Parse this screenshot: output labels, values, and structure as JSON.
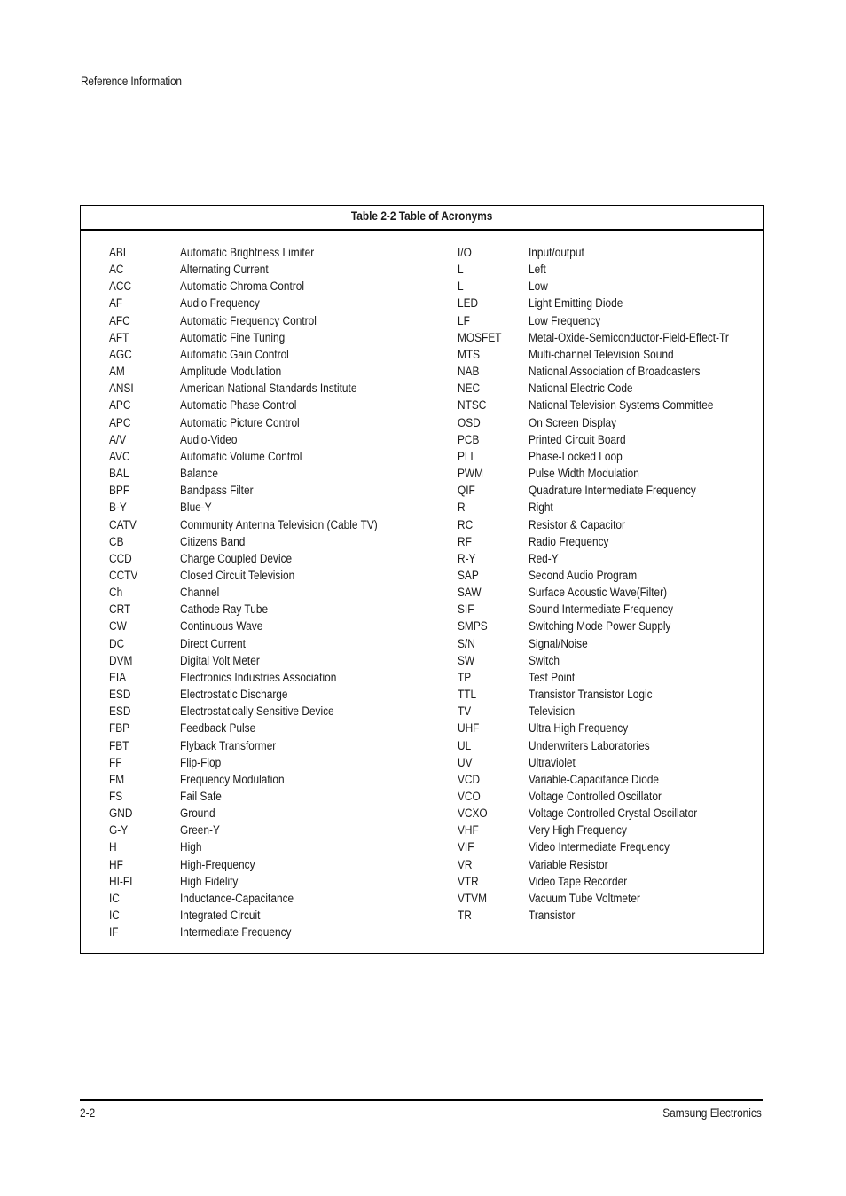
{
  "header": {
    "running_head": "Reference Information"
  },
  "table": {
    "title": "Table 2-2 Table of Acronyms",
    "left_column": [
      {
        "abbr": "ABL",
        "def": "Automatic Brightness Limiter"
      },
      {
        "abbr": "AC",
        "def": "Alternating Current"
      },
      {
        "abbr": "ACC",
        "def": "Automatic Chroma Control"
      },
      {
        "abbr": "AF",
        "def": "Audio Frequency"
      },
      {
        "abbr": "AFC",
        "def": "Automatic Frequency Control"
      },
      {
        "abbr": "AFT",
        "def": "Automatic Fine Tuning"
      },
      {
        "abbr": "AGC",
        "def": "Automatic Gain Control"
      },
      {
        "abbr": "AM",
        "def": "Amplitude Modulation"
      },
      {
        "abbr": "ANSI",
        "def": "American National Standards Institute"
      },
      {
        "abbr": "APC",
        "def": "Automatic Phase Control"
      },
      {
        "abbr": "APC",
        "def": "Automatic Picture Control"
      },
      {
        "abbr": "A/V",
        "def": "Audio-Video"
      },
      {
        "abbr": "AVC",
        "def": "Automatic Volume Control"
      },
      {
        "abbr": "BAL",
        "def": "Balance"
      },
      {
        "abbr": "BPF",
        "def": "Bandpass Filter"
      },
      {
        "abbr": "B-Y",
        "def": "Blue-Y"
      },
      {
        "abbr": "CATV",
        "def": "Community Antenna Television (Cable TV)"
      },
      {
        "abbr": "CB",
        "def": "Citizens Band"
      },
      {
        "abbr": "CCD",
        "def": "Charge Coupled Device"
      },
      {
        "abbr": "CCTV",
        "def": "Closed Circuit Television"
      },
      {
        "abbr": "Ch",
        "def": "Channel"
      },
      {
        "abbr": "CRT",
        "def": "Cathode Ray Tube"
      },
      {
        "abbr": "CW",
        "def": "Continuous Wave"
      },
      {
        "abbr": "DC",
        "def": "Direct Current"
      },
      {
        "abbr": "DVM",
        "def": "Digital Volt Meter"
      },
      {
        "abbr": "EIA",
        "def": "Electronics Industries Association"
      },
      {
        "abbr": "ESD",
        "def": "Electrostatic Discharge"
      },
      {
        "abbr": "ESD",
        "def": "Electrostatically Sensitive Device"
      },
      {
        "abbr": "FBP",
        "def": "Feedback Pulse"
      },
      {
        "abbr": "FBT",
        "def": "Flyback Transformer"
      },
      {
        "abbr": "FF",
        "def": "Flip-Flop"
      },
      {
        "abbr": "FM",
        "def": "Frequency Modulation"
      },
      {
        "abbr": "FS",
        "def": "Fail Safe"
      },
      {
        "abbr": "GND",
        "def": "Ground"
      },
      {
        "abbr": "G-Y",
        "def": "Green-Y"
      },
      {
        "abbr": "H",
        "def": "High"
      },
      {
        "abbr": "HF",
        "def": "High-Frequency"
      },
      {
        "abbr": "HI-FI",
        "def": "High Fidelity"
      },
      {
        "abbr": "IC",
        "def": "Inductance-Capacitance"
      },
      {
        "abbr": "IC",
        "def": "Integrated Circuit"
      },
      {
        "abbr": "IF",
        "def": "Intermediate Frequency"
      }
    ],
    "right_column": [
      {
        "abbr": "I/O",
        "def": "Input/output"
      },
      {
        "abbr": "L",
        "def": "Left"
      },
      {
        "abbr": "L",
        "def": "Low"
      },
      {
        "abbr": "LED",
        "def": "Light Emitting Diode"
      },
      {
        "abbr": "LF",
        "def": "Low Frequency"
      },
      {
        "abbr": "MOSFET",
        "def": "Metal-Oxide-Semiconductor-Field-Effect-Tr"
      },
      {
        "abbr": "MTS",
        "def": "Multi-channel Television Sound"
      },
      {
        "abbr": "NAB",
        "def": "National Association of Broadcasters"
      },
      {
        "abbr": "NEC",
        "def": "National Electric Code"
      },
      {
        "abbr": "NTSC",
        "def": "National Television Systems Committee"
      },
      {
        "abbr": "OSD",
        "def": "On Screen Display"
      },
      {
        "abbr": "PCB",
        "def": "Printed Circuit Board"
      },
      {
        "abbr": "PLL",
        "def": "Phase-Locked Loop"
      },
      {
        "abbr": "PWM",
        "def": "Pulse Width Modulation"
      },
      {
        "abbr": "QIF",
        "def": "Quadrature Intermediate Frequency"
      },
      {
        "abbr": "R",
        "def": "Right"
      },
      {
        "abbr": "RC",
        "def": "Resistor & Capacitor"
      },
      {
        "abbr": "RF",
        "def": "Radio Frequency"
      },
      {
        "abbr": "R-Y",
        "def": "Red-Y"
      },
      {
        "abbr": "SAP",
        "def": "Second Audio Program"
      },
      {
        "abbr": "SAW",
        "def": "Surface Acoustic Wave(Filter)"
      },
      {
        "abbr": "SIF",
        "def": "Sound Intermediate Frequency"
      },
      {
        "abbr": "SMPS",
        "def": "Switching Mode Power Supply"
      },
      {
        "abbr": "S/N",
        "def": "Signal/Noise"
      },
      {
        "abbr": "SW",
        "def": "Switch"
      },
      {
        "abbr": "TP",
        "def": "Test Point"
      },
      {
        "abbr": "TTL",
        "def": "Transistor Transistor Logic"
      },
      {
        "abbr": "TV",
        "def": "Television"
      },
      {
        "abbr": "UHF",
        "def": "Ultra High Frequency"
      },
      {
        "abbr": "UL",
        "def": "Underwriters Laboratories"
      },
      {
        "abbr": "UV",
        "def": "Ultraviolet"
      },
      {
        "abbr": "VCD",
        "def": "Variable-Capacitance Diode"
      },
      {
        "abbr": "VCO",
        "def": "Voltage Controlled Oscillator"
      },
      {
        "abbr": "VCXO",
        "def": "Voltage Controlled Crystal Oscillator"
      },
      {
        "abbr": "VHF",
        "def": "Very High Frequency"
      },
      {
        "abbr": "VIF",
        "def": "Video Intermediate Frequency"
      },
      {
        "abbr": "VR",
        "def": "Variable Resistor"
      },
      {
        "abbr": "VTR",
        "def": "Video Tape Recorder"
      },
      {
        "abbr": "VTVM",
        "def": "Vacuum Tube Voltmeter"
      },
      {
        "abbr": "TR",
        "def": "Transistor"
      }
    ]
  },
  "footer": {
    "page_number": "2-2",
    "company": "Samsung Electronics"
  }
}
